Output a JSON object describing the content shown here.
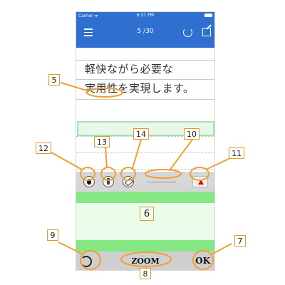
{
  "status_bar": {
    "carrier": "Carrier ᯤ",
    "time": "6:21 PM"
  },
  "navbar": {
    "page_indicator": "5 /30"
  },
  "notepad": {
    "lines": [
      "軽快ながら必要な",
      "実用性を実現します。"
    ]
  },
  "bottombar": {
    "zoom_label": "ZOOM",
    "ok_label": "OK"
  },
  "callouts": {
    "n5": "5",
    "n6": "6",
    "n7": "7",
    "n8": "8",
    "n9": "9",
    "n10": "10",
    "n11": "11",
    "n12": "12",
    "n13": "13",
    "n14": "14"
  },
  "icons": {
    "menu": "menu-icon",
    "refresh": "refresh-icon",
    "edit": "edit-icon",
    "ink": "ink-drop-icon",
    "pen": "pen-icon",
    "eraser": "eraser-icon",
    "up": "up-triangle-icon",
    "rotate": "rotate-icon"
  },
  "colors": {
    "navbar": "#2f6fcf",
    "zoom_band": "#84e784",
    "active_line": "#a6e0b0",
    "callout_border": "#e39a2a",
    "callout_stroke": "#f0a030",
    "triangle": "#e00000"
  }
}
